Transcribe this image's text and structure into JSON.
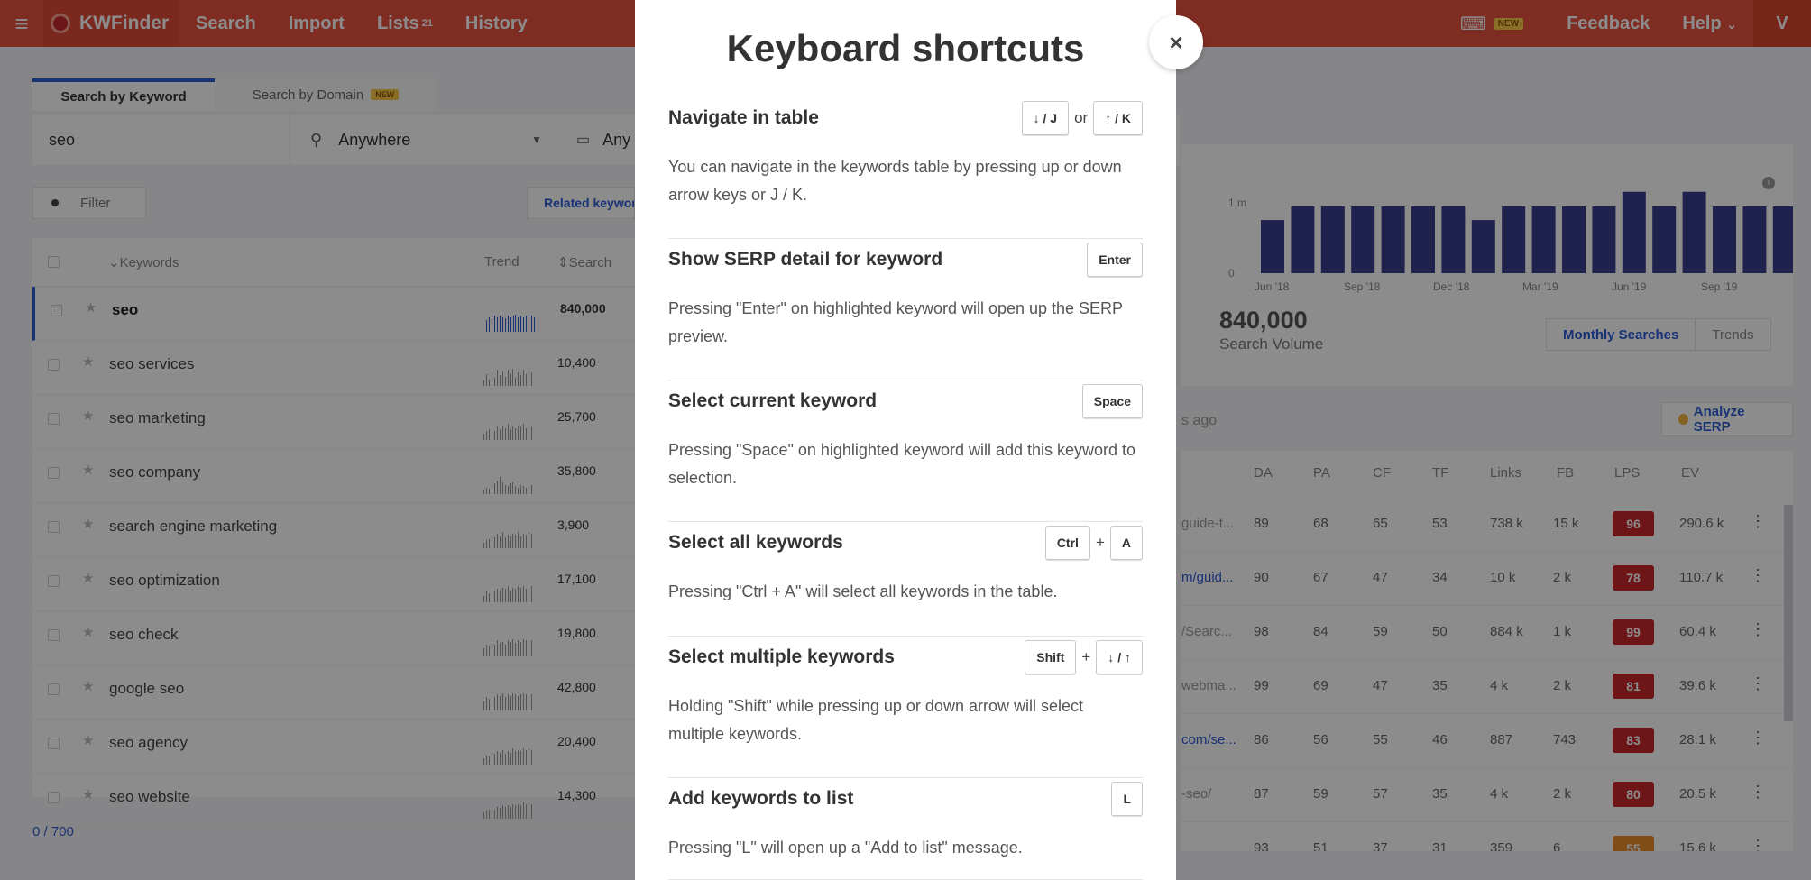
{
  "topbar": {
    "brand": "KWFinder",
    "nav": [
      {
        "label": "Search"
      },
      {
        "label": "Import"
      },
      {
        "label": "Lists",
        "badge": "21"
      },
      {
        "label": "History"
      }
    ],
    "new_badge": "NEW",
    "feedback": "Feedback",
    "help": "Help",
    "help_caret": "⌄",
    "avatar": "V"
  },
  "search": {
    "tab_keyword": "Search by Keyword",
    "tab_domain": "Search by Domain",
    "tab_domain_badge": "NEW",
    "keyword": "seo",
    "location": "Anywhere",
    "language": "Any"
  },
  "toolbar": {
    "filter_label": "Filter",
    "related_label": "Related keywords"
  },
  "kw_table": {
    "headers": {
      "keywords": "Keywords",
      "trend": "Trend",
      "search": "Search"
    },
    "rows": [
      {
        "keyword": "seo",
        "volume": "840,000"
      },
      {
        "keyword": "seo services",
        "volume": "10,400"
      },
      {
        "keyword": "seo marketing",
        "volume": "25,700"
      },
      {
        "keyword": "seo company",
        "volume": "35,800"
      },
      {
        "keyword": "search engine marketing",
        "volume": "3,900"
      },
      {
        "keyword": "seo optimization",
        "volume": "17,100"
      },
      {
        "keyword": "seo check",
        "volume": "19,800"
      },
      {
        "keyword": "google seo",
        "volume": "42,800"
      },
      {
        "keyword": "seo agency",
        "volume": "20,400"
      },
      {
        "keyword": "seo website",
        "volume": "14,300"
      }
    ],
    "selection_count": "0",
    "total": "700"
  },
  "trend_chart": {
    "y_ticks": [
      "1 m",
      "0"
    ],
    "x_ticks": [
      "Jun '18",
      "Sep '18",
      "Dec '18",
      "Mar '19",
      "Jun '19",
      "Sep '19"
    ],
    "values": [
      0.62,
      0.78,
      0.78,
      0.78,
      0.78,
      0.78,
      0.78,
      0.62,
      0.78,
      0.78,
      0.78,
      0.78,
      0.95,
      0.78,
      0.95,
      0.78,
      0.78,
      0.78,
      0.78
    ],
    "bar_color": "#3b3f8f",
    "search_volume": "840,000",
    "search_volume_label": "Search Volume",
    "toggle_monthly": "Monthly Searches",
    "toggle_trends": "Trends"
  },
  "serp": {
    "updated": "s ago",
    "analyze_label": "Analyze SERP",
    "headers": [
      "DA",
      "PA",
      "CF",
      "TF",
      "Links",
      "FB",
      "LPS",
      "EV"
    ],
    "rows": [
      {
        "url": "guide-t...",
        "link": false,
        "da": "89",
        "pa": "68",
        "cf": "65",
        "tf": "53",
        "links": "738 k",
        "fb": "15 k",
        "lps": "96",
        "ev": "290.6 k"
      },
      {
        "url": "m/guid...",
        "link": true,
        "da": "90",
        "pa": "67",
        "cf": "47",
        "tf": "34",
        "links": "10 k",
        "fb": "2 k",
        "lps": "78",
        "ev": "110.7 k"
      },
      {
        "url": "/Searc...",
        "link": false,
        "da": "98",
        "pa": "84",
        "cf": "59",
        "tf": "50",
        "links": "884 k",
        "fb": "1 k",
        "lps": "99",
        "ev": "60.4 k"
      },
      {
        "url": "webma...",
        "link": false,
        "da": "99",
        "pa": "69",
        "cf": "47",
        "tf": "35",
        "links": "4 k",
        "fb": "2 k",
        "lps": "81",
        "ev": "39.6 k"
      },
      {
        "url": "com/se...",
        "link": true,
        "da": "86",
        "pa": "56",
        "cf": "55",
        "tf": "46",
        "links": "887",
        "fb": "743",
        "lps": "83",
        "ev": "28.1 k"
      },
      {
        "url": "-seo/",
        "link": false,
        "da": "87",
        "pa": "59",
        "cf": "57",
        "tf": "35",
        "links": "4 k",
        "fb": "2 k",
        "lps": "80",
        "ev": "20.5 k"
      },
      {
        "url": "",
        "link": false,
        "da": "93",
        "pa": "51",
        "cf": "37",
        "tf": "31",
        "links": "359",
        "fb": "6",
        "lps": "55",
        "ev": "15.6 k",
        "lps_color": "orange"
      }
    ]
  },
  "modal": {
    "title": "Keyboard shortcuts",
    "close": "×",
    "sections": [
      {
        "title": "Navigate in table",
        "keys": [
          "↓ / J",
          "↑ / K"
        ],
        "joiner": "or",
        "desc": "You can navigate in the keywords table by pressing up or down arrow keys or J / K."
      },
      {
        "title": "Show SERP detail for keyword",
        "keys": [
          "Enter"
        ],
        "desc": "Pressing \"Enter\" on highlighted keyword will open up the SERP preview."
      },
      {
        "title": "Select current keyword",
        "keys": [
          "Space"
        ],
        "desc": "Pressing \"Space\" on highlighted keyword will add this keyword to selection."
      },
      {
        "title": "Select all keywords",
        "keys": [
          "Ctrl",
          "A"
        ],
        "joiner": "+",
        "desc": "Pressing \"Ctrl + A\" will select all keywords in the table."
      },
      {
        "title": "Select multiple keywords",
        "keys": [
          "Shift",
          "↓ / ↑"
        ],
        "joiner": "+",
        "desc": "Holding \"Shift\" while pressing up or down arrow will select multiple keywords."
      },
      {
        "title": "Add keywords to list",
        "keys": [
          "L"
        ],
        "desc": "Pressing \"L\" will open up a \"Add to list\" message."
      }
    ]
  }
}
